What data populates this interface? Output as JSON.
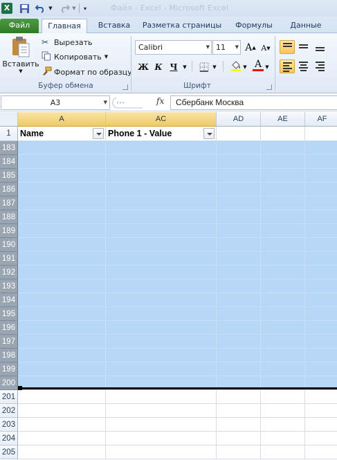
{
  "qat": {
    "app_icon": "excel-icon",
    "faded_title": "Файл - Excel - Microsoft Excel"
  },
  "tabs": [
    {
      "label": "Файл"
    },
    {
      "label": "Главная"
    },
    {
      "label": "Вставка"
    },
    {
      "label": "Разметка страницы"
    },
    {
      "label": "Формулы"
    },
    {
      "label": "Данные"
    }
  ],
  "ribbon": {
    "clipboard": {
      "paste_label": "Вставить",
      "cut_label": "Вырезать",
      "copy_label": "Копировать",
      "format_painter_label": "Формат по образцу",
      "group_label": "Буфер обмена"
    },
    "font": {
      "font_name": "Calibri",
      "font_size": "11",
      "bold": "Ж",
      "italic": "К",
      "underline": "Ч",
      "grow": "A",
      "shrink": "A",
      "font_color": "A",
      "group_label": "Шрифт"
    }
  },
  "formula_bar": {
    "name_box": "A3",
    "fx": "fx",
    "value": "Сбербанк Москва"
  },
  "grid": {
    "columns": [
      {
        "letter": "A",
        "selected": true
      },
      {
        "letter": "AC",
        "selected": true
      },
      {
        "letter": "AD",
        "selected": false
      },
      {
        "letter": "AE",
        "selected": false
      },
      {
        "letter": "AF",
        "selected": false
      }
    ],
    "header_row_number": "1",
    "header_cells": [
      "Name",
      "Phone 1 - Value"
    ],
    "rows": [
      "183",
      "184",
      "185",
      "186",
      "187",
      "188",
      "189",
      "190",
      "191",
      "192",
      "193",
      "194",
      "195",
      "196",
      "197",
      "198",
      "199",
      "200",
      "201",
      "202",
      "203",
      "204",
      "205"
    ],
    "selected_rows_last": "200"
  },
  "colors": {
    "selection": "#b7d7f7",
    "file_tab": "#2e7d26",
    "header_highlight": "#f1c96a"
  }
}
